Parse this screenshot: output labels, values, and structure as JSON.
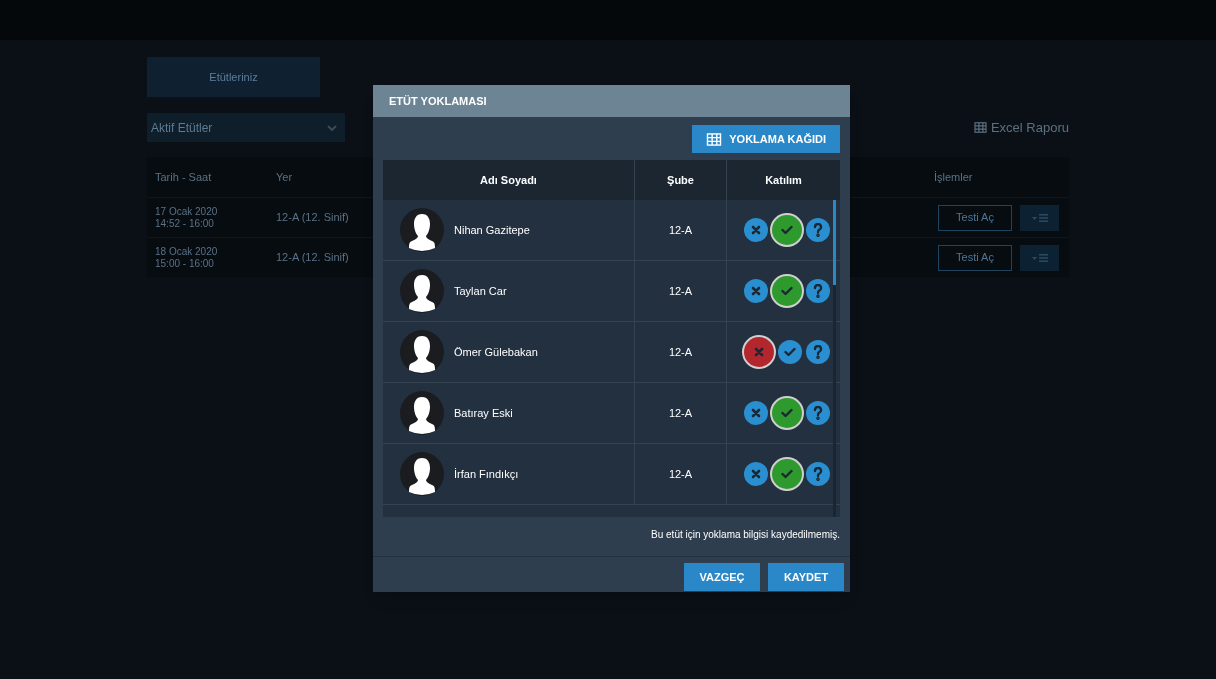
{
  "background": {
    "tabs": [
      {
        "label": "Etütleriniz",
        "selected": true
      }
    ],
    "filter": {
      "value": "Aktif Etütler"
    },
    "excel_button": "Excel Raporu",
    "table": {
      "columns": [
        "Tarih - Saat",
        "Yer",
        "İşlemler"
      ],
      "rows": [
        {
          "date": "17 Ocak 2020",
          "time": "14:52 - 16:00",
          "place": "12-A (12. Sinif)",
          "action": "Testi Aç"
        },
        {
          "date": "18 Ocak 2020",
          "time": "15:00 - 16:00",
          "place": "12-A (12. Sinif)",
          "action": "Testi Aç"
        }
      ]
    }
  },
  "dialog": {
    "title": "ETÜT YOKLAMASI",
    "sheet_button": "YOKLAMA KAĞIDI",
    "columns": [
      "Adı Soyadı",
      "Şube",
      "Katılım"
    ],
    "students": [
      {
        "name": "Nihan Gazitepe",
        "branch": "12-A",
        "choices": [
          {
            "kind": "absent",
            "selected": false
          },
          {
            "kind": "present",
            "selected": true
          },
          {
            "kind": "unknown",
            "selected": false
          }
        ]
      },
      {
        "name": "Taylan Car",
        "branch": "12-A",
        "choices": [
          {
            "kind": "absent",
            "selected": false
          },
          {
            "kind": "present",
            "selected": true
          },
          {
            "kind": "unknown",
            "selected": false
          }
        ]
      },
      {
        "name": "Ömer Gülebakan",
        "branch": "12-A",
        "choices": [
          {
            "kind": "absent",
            "selected": true
          },
          {
            "kind": "present",
            "selected": false
          },
          {
            "kind": "unknown",
            "selected": false
          }
        ]
      },
      {
        "name": "Batıray Eski",
        "branch": "12-A",
        "choices": [
          {
            "kind": "absent",
            "selected": false
          },
          {
            "kind": "present",
            "selected": true
          },
          {
            "kind": "unknown",
            "selected": false
          }
        ]
      },
      {
        "name": "İrfan Fındıkçı",
        "branch": "12-A",
        "choices": [
          {
            "kind": "absent",
            "selected": false
          },
          {
            "kind": "present",
            "selected": true
          },
          {
            "kind": "unknown",
            "selected": false
          }
        ]
      }
    ],
    "note": "Bu etüt için yoklama bilgisi kaydedilmemiş.",
    "buttons": [
      "VAZGEÇ",
      "KAYDET"
    ]
  }
}
